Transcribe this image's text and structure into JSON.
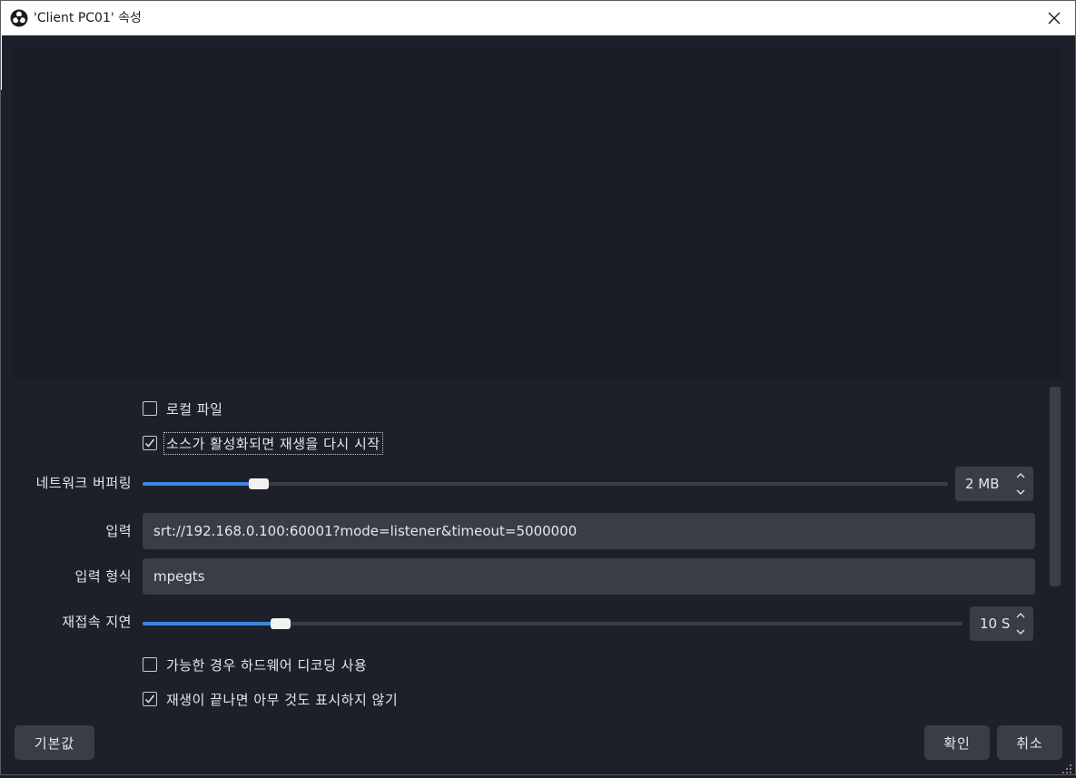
{
  "window": {
    "title": "'Client PC01' 속성",
    "app_icon": "obs-logo-icon",
    "close_icon": "close-icon"
  },
  "properties": {
    "local_file": {
      "label": "로컬 파일",
      "checked": false
    },
    "restart_on_activate": {
      "label": "소스가 활성화되면 재생을 다시 시작",
      "checked": true
    },
    "network_buffering": {
      "label": "네트워크 버퍼링",
      "value_text": "2 MB",
      "fraction": 0.135
    },
    "input": {
      "label": "입력",
      "value": "srt://192.168.0.100:60001?mode=listener&timeout=5000000"
    },
    "input_format": {
      "label": "입력 형식",
      "value": "mpegts"
    },
    "reconnect_delay": {
      "label": "재접속 지연",
      "value_text": "10 S",
      "fraction": 0.16
    },
    "hw_decode": {
      "label": "가능한 경우 하드웨어 디코딩 사용",
      "checked": false
    },
    "close_when_inactive": {
      "label": "재생이 끝나면 아무 것도 표시하지 않기",
      "checked": true
    }
  },
  "buttons": {
    "defaults": "기본값",
    "ok": "확인",
    "cancel": "취소"
  },
  "colors": {
    "background": "#1e2029",
    "field": "#3a3d48",
    "accent": "#3b87e0"
  }
}
